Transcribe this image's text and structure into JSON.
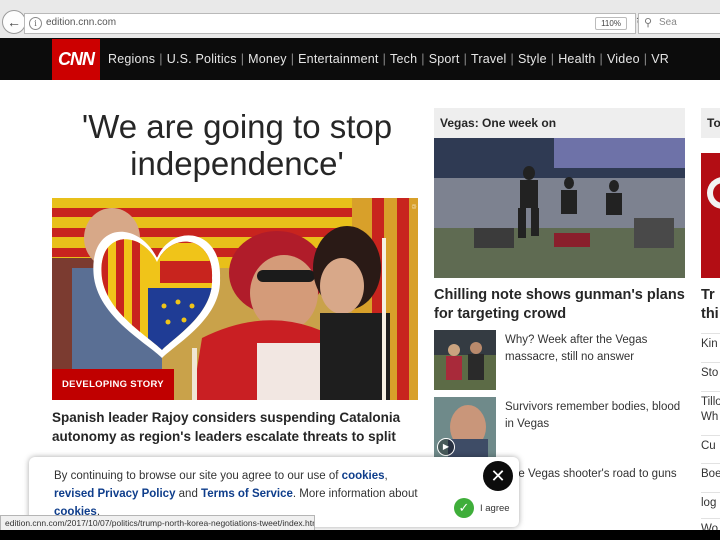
{
  "browser": {
    "url": "edition.cnn.com",
    "zoom": "110%",
    "search_placeholder": "Sea",
    "status_url": "edition.cnn.com/2017/10/07/politics/trump-north-korea-negotiations-tweet/index.html"
  },
  "site": {
    "logo": "CNN",
    "nav": [
      "Regions",
      "U.S. Politics",
      "Money",
      "Entertainment",
      "Tech",
      "Sport",
      "Travel",
      "Style",
      "Health",
      "Video",
      "VR"
    ]
  },
  "lead": {
    "headline": "'We are going to stop independence'",
    "badge": "DEVELOPING STORY",
    "summary": "Spanish leader Rajoy considers suspending Catalonia autonomy as region's leaders escalate threats to split"
  },
  "vegas": {
    "section": "Vegas: One week on",
    "title": "Chilling note shows gunman's plans for targeting crowd",
    "related": [
      {
        "text": "Why? Week after the Vegas massacre, still no answer"
      },
      {
        "text": "Survivors remember bodies, blood in Vegas"
      },
      {
        "text": "The Vegas shooter's road to guns"
      }
    ]
  },
  "right_column": {
    "section": "To",
    "title_line1": "Tr",
    "title_line2": "thi",
    "items": [
      "Kin",
      "Sto",
      "Tillo",
      "Wh",
      "Cu",
      "Boe",
      "log",
      "Wo"
    ]
  },
  "cookie": {
    "text_before": "By continuing to browse our site you agree to our use of ",
    "link_cookies": "cookies",
    "sep1": ",",
    "link_privacy": "revised Privacy Policy",
    "and": " and ",
    "link_terms": "Terms of Service",
    "text_after": ". More information about ",
    "link_cookies2": "cookies",
    "period": ".",
    "agree_label": "I agree"
  }
}
